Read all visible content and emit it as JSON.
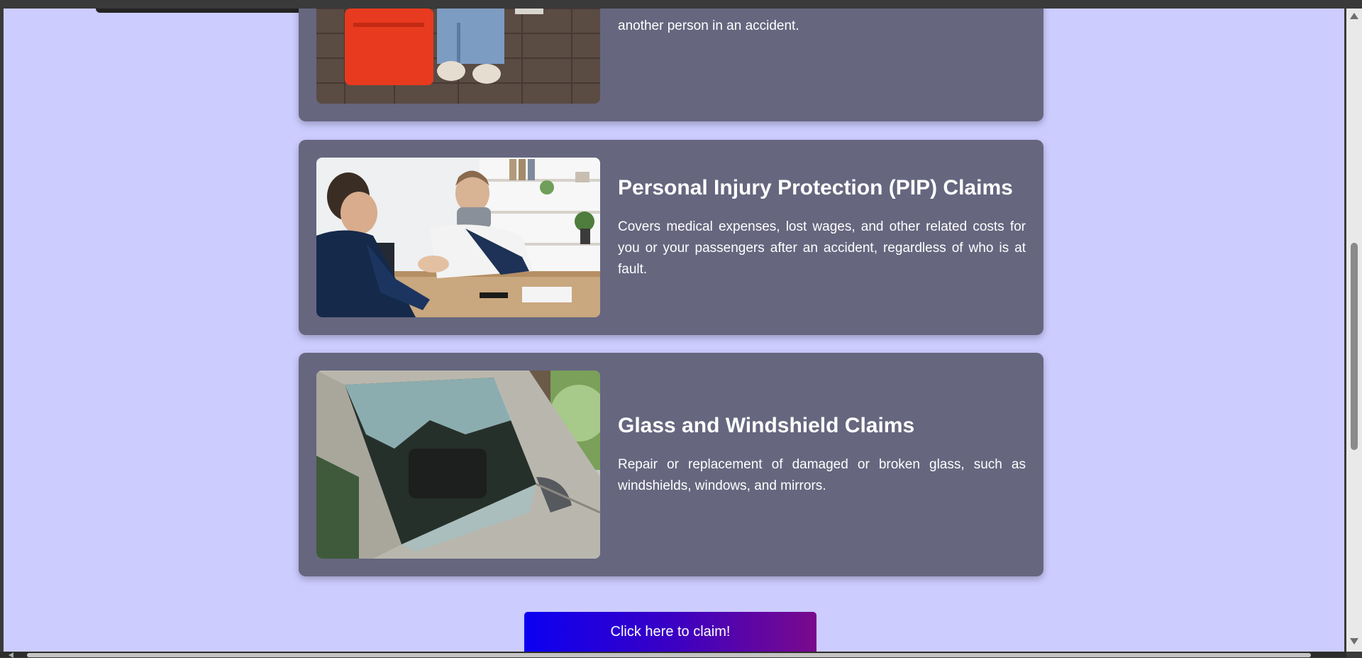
{
  "cards": [
    {
      "title": "",
      "description": "another person in an accident."
    },
    {
      "title": "Personal Injury Protection (PIP) Claims",
      "description": "Covers medical expenses, lost wages, and other related costs for you or your passengers after an accident, regardless of who is at fault."
    },
    {
      "title": "Glass and Windshield Claims",
      "description": "Repair or replacement of damaged or broken glass, such as windshields, windows, and mirrors."
    }
  ],
  "cta": {
    "label": "Click here to claim!"
  },
  "colors": {
    "page_background": "#ccccff",
    "card_background": "#66667f",
    "card_text": "#ffffff",
    "cta_gradient_start": "#0b00f2",
    "cta_gradient_end": "#7a0a8c"
  }
}
